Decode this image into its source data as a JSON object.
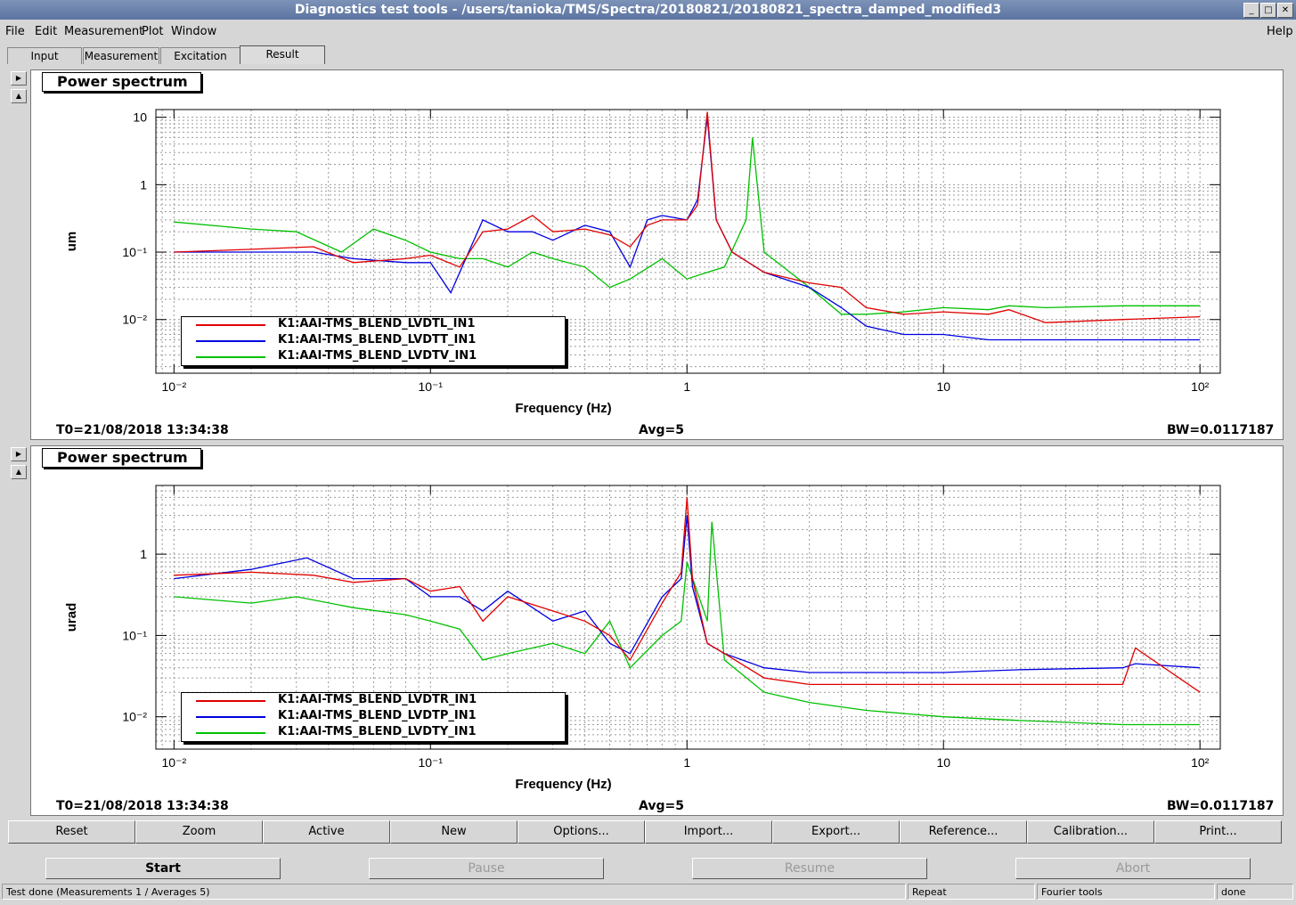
{
  "window": {
    "title": "Diagnostics test tools - /users/tanioka/TMS/Spectra/20180821/20180821_spectra_damped_modified3",
    "controls": [
      "minimize-icon",
      "maximize-icon",
      "close-icon"
    ]
  },
  "menu": {
    "file": "File",
    "edit": "Edit",
    "measurement": "Measurement",
    "plot": "Plot",
    "window": "Window",
    "help": "Help"
  },
  "tabs": {
    "input": "Input",
    "measurement": "Measurement",
    "excitation": "Excitation",
    "result": "Result",
    "selected": "Result"
  },
  "panels": [
    {
      "title": "Power spectrum",
      "ylabel": "um",
      "xlabel": "Frequency (Hz)",
      "yticks": [
        "10",
        "1",
        "10⁻¹",
        "10⁻²"
      ],
      "xticks": [
        "10⁻²",
        "10⁻¹",
        "1",
        "10",
        "10²"
      ],
      "t0": "T0=21/08/2018 13:34:38",
      "avg": "Avg=5",
      "bw": "BW=0.0117187",
      "legend": [
        {
          "name": "K1:AAI-TMS_BLEND_LVDTL_IN1",
          "color": "#e00000"
        },
        {
          "name": "K1:AAI-TMS_BLEND_LVDTT_IN1",
          "color": "#0000e0"
        },
        {
          "name": "K1:AAI-TMS_BLEND_LVDTV_IN1",
          "color": "#00c000"
        }
      ]
    },
    {
      "title": "Power spectrum",
      "ylabel": "urad",
      "xlabel": "Frequency (Hz)",
      "yticks": [
        "1",
        "10⁻¹",
        "10⁻²"
      ],
      "xticks": [
        "10⁻²",
        "10⁻¹",
        "1",
        "10",
        "10²"
      ],
      "t0": "T0=21/08/2018 13:34:38",
      "avg": "Avg=5",
      "bw": "BW=0.0117187",
      "legend": [
        {
          "name": "K1:AAI-TMS_BLEND_LVDTR_IN1",
          "color": "#e00000"
        },
        {
          "name": "K1:AAI-TMS_BLEND_LVDTP_IN1",
          "color": "#0000e0"
        },
        {
          "name": "K1:AAI-TMS_BLEND_LVDTY_IN1",
          "color": "#00c000"
        }
      ]
    }
  ],
  "chart_data": [
    {
      "type": "line",
      "title": "Power spectrum",
      "xlabel": "Frequency (Hz)",
      "ylabel": "um",
      "xscale": "log",
      "yscale": "log",
      "xlim": [
        0.0085,
        120
      ],
      "ylim": [
        0.0016,
        13
      ],
      "grid": true,
      "legend_position": "bottom-left",
      "series": [
        {
          "name": "K1:AAI-TMS_BLEND_LVDTL_IN1",
          "x": [
            0.01,
            0.02,
            0.035,
            0.05,
            0.08,
            0.1,
            0.13,
            0.16,
            0.2,
            0.25,
            0.3,
            0.4,
            0.5,
            0.6,
            0.7,
            0.8,
            1.0,
            1.1,
            1.2,
            1.3,
            1.5,
            2,
            3,
            4,
            5,
            7,
            10,
            15,
            18,
            25,
            50,
            100
          ],
          "y": [
            0.1,
            0.11,
            0.12,
            0.07,
            0.08,
            0.09,
            0.06,
            0.2,
            0.22,
            0.35,
            0.2,
            0.22,
            0.18,
            0.12,
            0.25,
            0.3,
            0.3,
            0.5,
            12,
            0.3,
            0.1,
            0.05,
            0.035,
            0.03,
            0.015,
            0.012,
            0.013,
            0.012,
            0.014,
            0.009,
            0.01,
            0.011
          ]
        },
        {
          "name": "K1:AAI-TMS_BLEND_LVDTT_IN1",
          "x": [
            0.01,
            0.02,
            0.035,
            0.05,
            0.08,
            0.1,
            0.12,
            0.16,
            0.2,
            0.25,
            0.3,
            0.4,
            0.5,
            0.6,
            0.7,
            0.8,
            1.0,
            1.1,
            1.2,
            1.3,
            1.5,
            2,
            3,
            4,
            5,
            7,
            10,
            15,
            18,
            25,
            50,
            100
          ],
          "y": [
            0.1,
            0.1,
            0.1,
            0.08,
            0.07,
            0.07,
            0.025,
            0.3,
            0.2,
            0.2,
            0.15,
            0.25,
            0.2,
            0.06,
            0.3,
            0.35,
            0.3,
            0.6,
            10,
            0.3,
            0.1,
            0.05,
            0.03,
            0.015,
            0.008,
            0.006,
            0.006,
            0.005,
            0.005,
            0.005,
            0.005,
            0.005
          ]
        },
        {
          "name": "K1:AAI-TMS_BLEND_LVDTV_IN1",
          "x": [
            0.01,
            0.02,
            0.03,
            0.045,
            0.06,
            0.08,
            0.1,
            0.13,
            0.16,
            0.2,
            0.25,
            0.3,
            0.4,
            0.5,
            0.6,
            0.8,
            1.0,
            1.2,
            1.4,
            1.7,
            1.8,
            2,
            3,
            4,
            5,
            7,
            10,
            15,
            18,
            25,
            50,
            100
          ],
          "y": [
            0.28,
            0.22,
            0.2,
            0.1,
            0.22,
            0.15,
            0.1,
            0.08,
            0.08,
            0.06,
            0.1,
            0.08,
            0.06,
            0.03,
            0.04,
            0.08,
            0.04,
            0.05,
            0.06,
            0.3,
            5,
            0.1,
            0.03,
            0.012,
            0.012,
            0.013,
            0.015,
            0.014,
            0.016,
            0.015,
            0.016,
            0.016
          ]
        }
      ]
    },
    {
      "type": "line",
      "title": "Power spectrum",
      "xlabel": "Frequency (Hz)",
      "ylabel": "urad",
      "xscale": "log",
      "yscale": "log",
      "xlim": [
        0.0085,
        120
      ],
      "ylim": [
        0.004,
        7
      ],
      "grid": true,
      "legend_position": "bottom-left",
      "series": [
        {
          "name": "K1:AAI-TMS_BLEND_LVDTR_IN1",
          "x": [
            0.01,
            0.02,
            0.035,
            0.05,
            0.08,
            0.1,
            0.13,
            0.16,
            0.2,
            0.3,
            0.4,
            0.5,
            0.6,
            0.8,
            0.95,
            1.0,
            1.05,
            1.2,
            1.4,
            2,
            3,
            5,
            10,
            20,
            50,
            56,
            100
          ],
          "y": [
            0.55,
            0.6,
            0.55,
            0.45,
            0.5,
            0.35,
            0.4,
            0.15,
            0.3,
            0.2,
            0.15,
            0.1,
            0.05,
            0.25,
            0.6,
            5,
            0.5,
            0.08,
            0.06,
            0.03,
            0.025,
            0.025,
            0.025,
            0.025,
            0.025,
            0.07,
            0.02
          ]
        },
        {
          "name": "K1:AAI-TMS_BLEND_LVDTP_IN1",
          "x": [
            0.01,
            0.02,
            0.033,
            0.05,
            0.08,
            0.1,
            0.13,
            0.16,
            0.2,
            0.3,
            0.4,
            0.5,
            0.6,
            0.8,
            0.95,
            1.0,
            1.05,
            1.2,
            1.4,
            2,
            3,
            5,
            10,
            20,
            50,
            56,
            100
          ],
          "y": [
            0.5,
            0.65,
            0.9,
            0.5,
            0.5,
            0.3,
            0.3,
            0.2,
            0.35,
            0.15,
            0.2,
            0.08,
            0.06,
            0.3,
            0.5,
            3,
            0.4,
            0.08,
            0.06,
            0.04,
            0.035,
            0.035,
            0.035,
            0.038,
            0.04,
            0.045,
            0.04
          ]
        },
        {
          "name": "K1:AAI-TMS_BLEND_LVDTY_IN1",
          "x": [
            0.01,
            0.02,
            0.03,
            0.05,
            0.08,
            0.1,
            0.13,
            0.16,
            0.2,
            0.3,
            0.4,
            0.5,
            0.6,
            0.8,
            0.95,
            1.0,
            1.2,
            1.25,
            1.4,
            2,
            3,
            5,
            10,
            20,
            50,
            100
          ],
          "y": [
            0.3,
            0.25,
            0.3,
            0.22,
            0.18,
            0.15,
            0.12,
            0.05,
            0.06,
            0.08,
            0.06,
            0.15,
            0.04,
            0.1,
            0.15,
            0.8,
            0.15,
            2.5,
            0.05,
            0.02,
            0.015,
            0.012,
            0.01,
            0.009,
            0.008,
            0.008
          ]
        }
      ]
    }
  ],
  "buttons": {
    "reset": "Reset",
    "zoom": "Zoom",
    "active": "Active",
    "new": "New",
    "options": "Options...",
    "import": "Import...",
    "export": "Export...",
    "reference": "Reference...",
    "calibration": "Calibration...",
    "print": "Print..."
  },
  "run_buttons": {
    "start": "Start",
    "pause": "Pause",
    "resume": "Resume",
    "abort": "Abort"
  },
  "status": {
    "message": "Test done (Measurements 1 / Averages 5)",
    "repeat": "Repeat",
    "tools": "Fourier tools",
    "state": "done"
  }
}
